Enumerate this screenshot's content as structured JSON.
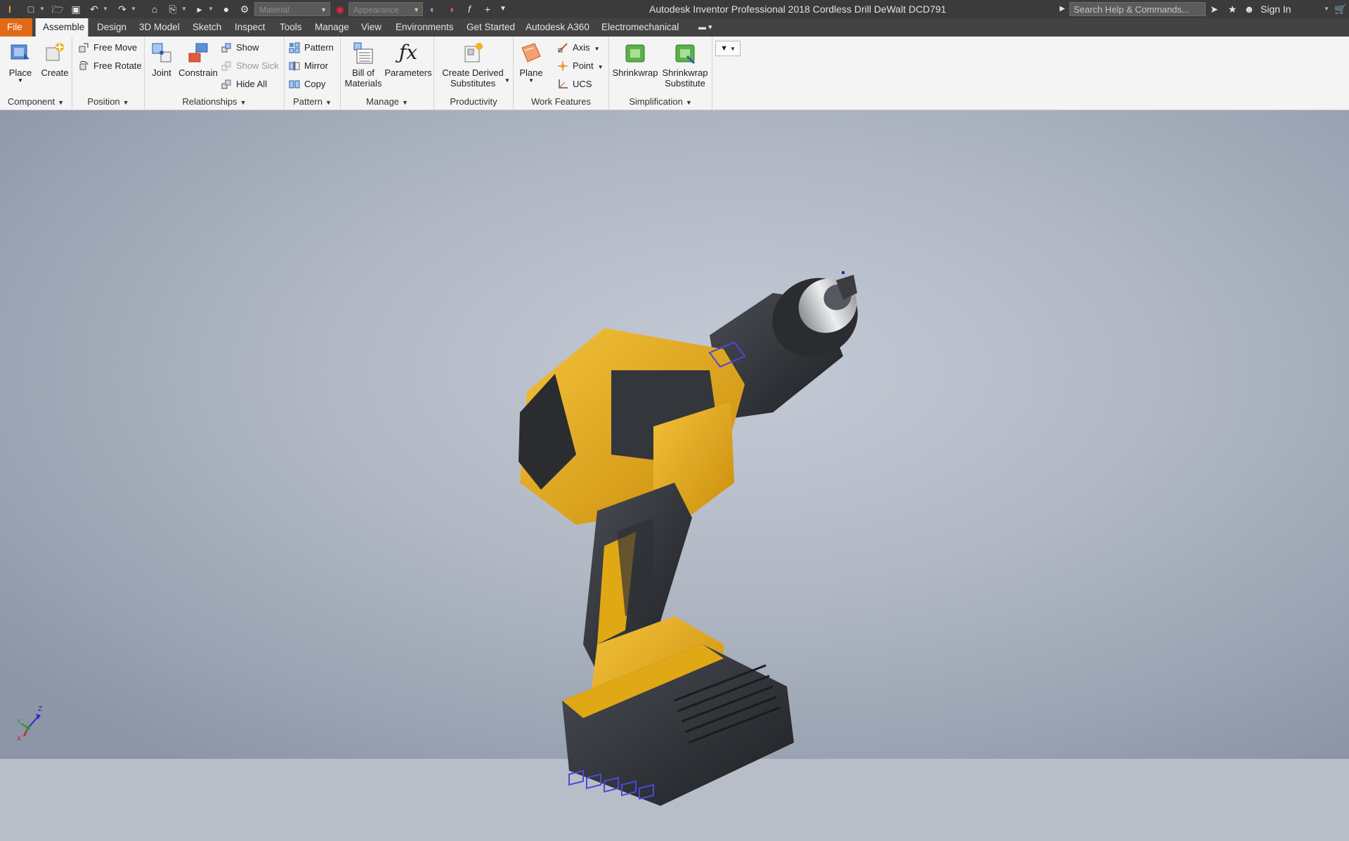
{
  "titlebar": {
    "app_title": "Autodesk Inventor Professional 2018   Cordless Drill DeWalt DCD791",
    "material_combo": "Material",
    "appearance_combo": "Appearance",
    "help_search_placeholder": "Search Help & Commands...",
    "sign_in": "Sign In",
    "qat_icons": [
      "inventor-logo-icon",
      "new-icon",
      "open-icon",
      "save-icon",
      "undo-icon",
      "redo-icon",
      "home-icon",
      "print-icon",
      "select-icon",
      "update-icon",
      "settings-icon",
      "appearance-icon",
      "adjust-icon",
      "clear-icon",
      "fx-icon",
      "plus-icon",
      "customize-icon"
    ]
  },
  "tabs": [
    {
      "label": "File"
    },
    {
      "label": "Assemble"
    },
    {
      "label": "Design"
    },
    {
      "label": "3D Model"
    },
    {
      "label": "Sketch"
    },
    {
      "label": "Inspect"
    },
    {
      "label": "Tools"
    },
    {
      "label": "Manage"
    },
    {
      "label": "View"
    },
    {
      "label": "Environments"
    },
    {
      "label": "Get Started"
    },
    {
      "label": "Autodesk A360"
    },
    {
      "label": "Electromechanical"
    }
  ],
  "ribbon": {
    "component": {
      "label": "Component",
      "place": "Place",
      "create": "Create"
    },
    "position": {
      "label": "Position",
      "free_move": "Free Move",
      "free_rotate": "Free Rotate"
    },
    "relationships": {
      "label": "Relationships",
      "joint": "Joint",
      "constrain": "Constrain",
      "show": "Show",
      "show_sick": "Show Sick",
      "hide_all": "Hide All"
    },
    "pattern": {
      "label": "Pattern",
      "pattern": "Pattern",
      "mirror": "Mirror",
      "copy": "Copy"
    },
    "manage": {
      "label": "Manage",
      "bom_line1": "Bill of",
      "bom_line2": "Materials",
      "parameters": "Parameters"
    },
    "productivity": {
      "label": "Productivity",
      "derived_line1": "Create Derived",
      "derived_line2": "Substitutes"
    },
    "work_features": {
      "label": "Work Features",
      "plane": "Plane",
      "axis": "Axis",
      "point": "Point",
      "ucs": "UCS"
    },
    "simplification": {
      "label": "Simplification",
      "shrinkwrap": "Shrinkwrap",
      "shrinkwrap_sub_line1": "Shrinkwrap",
      "shrinkwrap_sub_line2": "Substitute"
    }
  },
  "viewport": {
    "triad_axes": [
      "Z",
      "Y",
      "X"
    ]
  },
  "colors": {
    "file_tab": "#e06a16",
    "drill_yellow": "#e0a814",
    "drill_dark": "#2a2c30"
  }
}
